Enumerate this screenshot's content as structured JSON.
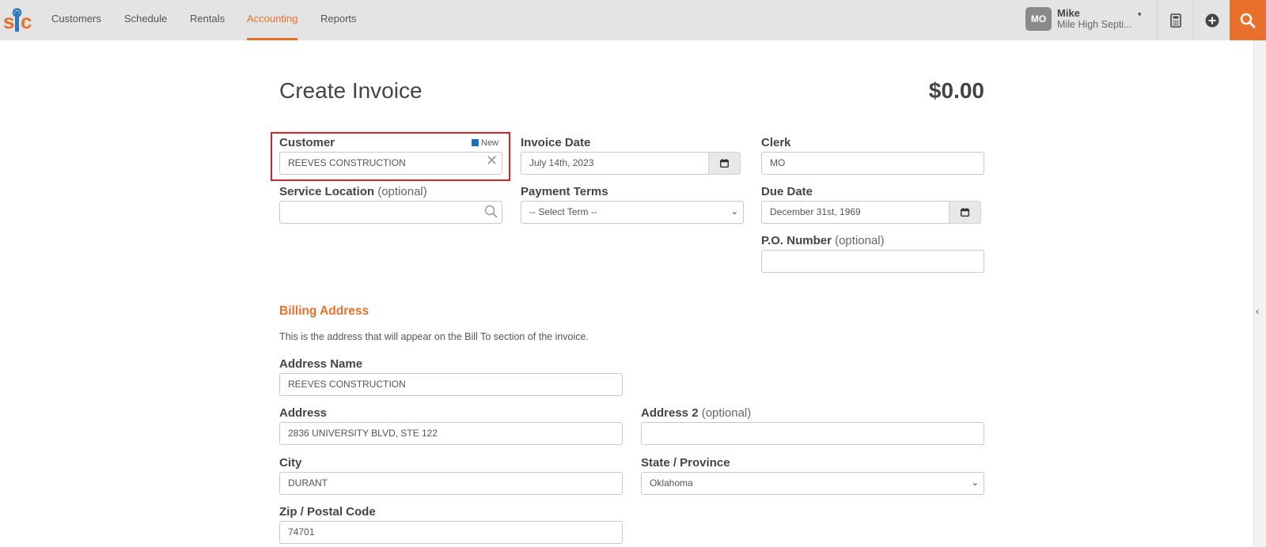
{
  "nav": {
    "items": [
      "Customers",
      "Schedule",
      "Rentals",
      "Accounting",
      "Reports"
    ],
    "active": "Accounting"
  },
  "user": {
    "initials": "MO",
    "name": "Mike",
    "company": "Mile High Septi..."
  },
  "colors": {
    "accent": "#e8702a",
    "highlight": "#e31e1e",
    "badge": "#1f6fb8"
  },
  "page": {
    "title": "Create Invoice",
    "total": "$0.00"
  },
  "form": {
    "customer": {
      "label": "Customer",
      "value": "REEVES CONSTRUCTION",
      "new_label": "New"
    },
    "invoice_date": {
      "label": "Invoice Date",
      "value": "July 14th, 2023"
    },
    "clerk": {
      "label": "Clerk",
      "value": "MO"
    },
    "service_location": {
      "label": "Service Location",
      "optional": "(optional)",
      "value": ""
    },
    "payment_terms": {
      "label": "Payment Terms",
      "value": "-- Select Term --"
    },
    "due_date": {
      "label": "Due Date",
      "value": "December 31st, 1969"
    },
    "po_number": {
      "label": "P.O. Number",
      "optional": "(optional)",
      "value": ""
    }
  },
  "billing": {
    "title": "Billing Address",
    "description": "This is the address that will appear on the Bill To section of the invoice.",
    "address_name": {
      "label": "Address Name",
      "value": "REEVES CONSTRUCTION"
    },
    "address": {
      "label": "Address",
      "value": "2836 UNIVERSITY BLVD, STE 122"
    },
    "address2": {
      "label": "Address 2",
      "optional": "(optional)",
      "value": ""
    },
    "city": {
      "label": "City",
      "value": "DURANT"
    },
    "state": {
      "label": "State / Province",
      "value": "Oklahoma"
    },
    "zip": {
      "label": "Zip / Postal Code",
      "value": "74701"
    }
  }
}
